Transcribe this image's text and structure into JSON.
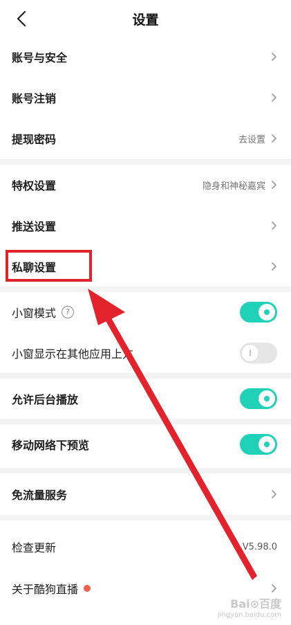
{
  "header": {
    "title": "设置"
  },
  "rows": {
    "account_security": {
      "label": "账号与安全"
    },
    "account_cancel": {
      "label": "账号注销"
    },
    "withdraw_pwd": {
      "label": "提现密码",
      "value": "去设置"
    },
    "privilege": {
      "label": "特权设置",
      "value": "隐身和神秘嘉宾"
    },
    "push": {
      "label": "推送设置"
    },
    "private_chat": {
      "label": "私聊设置"
    },
    "mini_window": {
      "label": "小窗模式",
      "help": "?",
      "enabled": true
    },
    "mini_over_apps": {
      "label": "小窗显示在其他应用上方",
      "enabled": false
    },
    "background_play": {
      "label": "允许后台播放",
      "enabled": true
    },
    "mobile_preview": {
      "label": "移动网络下预览",
      "enabled": true
    },
    "free_data": {
      "label": "免流量服务"
    },
    "check_update": {
      "label": "检查更新",
      "value": "V5.98.0"
    },
    "about": {
      "label": "关于酷狗直播"
    }
  },
  "colors": {
    "toggle_on": "#1fd1b7",
    "toggle_off": "#e6e6e6",
    "annotation": "#e3232c",
    "badge": "#f0604a"
  },
  "watermark": {
    "brand": "Bai⊙百度",
    "sub": "jingyan.baidu.com"
  }
}
